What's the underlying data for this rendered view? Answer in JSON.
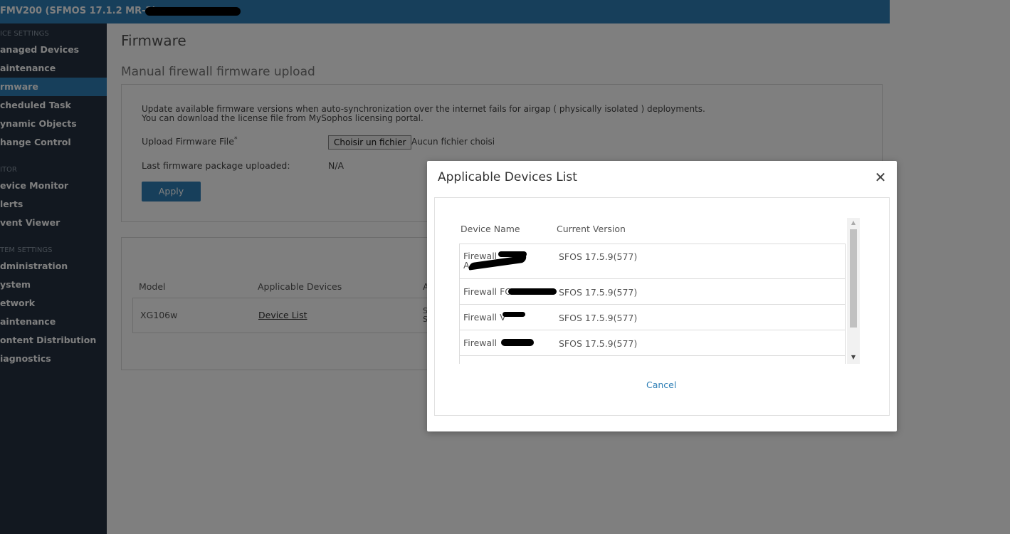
{
  "header": {
    "title": "FMV200 (SFMOS 17.1.2 MR-2) - "
  },
  "sidebar": {
    "sections": [
      {
        "label": "ICE SETTINGS",
        "items": [
          "anaged Devices",
          "aintenance",
          "rmware",
          "cheduled Task",
          "ynamic Objects",
          "hange Control"
        ]
      },
      {
        "label": "ITOR",
        "items": [
          "evice Monitor",
          "lerts",
          "vent Viewer"
        ]
      },
      {
        "label": "TEM SETTINGS",
        "items": [
          "dministration",
          "ystem",
          "etwork",
          "aintenance",
          "ontent Distribution",
          "iagnostics"
        ]
      }
    ],
    "active_item": "rmware"
  },
  "main": {
    "page_title": "Firmware",
    "section_title": "Manual firewall firmware upload",
    "description_line1": "Update available firmware versions when auto-synchronization over the internet fails for airgap ( physically isolated ) deployments.",
    "description_line2": "You can download the license file from MySophos licensing portal.",
    "upload_label": "Upload Firmware File",
    "required_marker": "*",
    "choose_file_button": "Choisir un fichier",
    "no_file_text": "Aucun fichier choisi",
    "last_uploaded_label": "Last firmware package uploaded:",
    "last_uploaded_value": "N/A",
    "apply_button": "Apply",
    "table": {
      "headers": [
        "Model",
        "Applicable Devices",
        "A"
      ],
      "rows": [
        {
          "model": "XG106w",
          "devices_link": "Device List",
          "partial_a": "S",
          "partial_b": "S"
        }
      ]
    }
  },
  "modal": {
    "title": "Applicable Devices List",
    "close_symbol": "✕",
    "columns": [
      "Device Name",
      "Current Version"
    ],
    "rows": [
      {
        "name_line1": "Firewall",
        "name_line2": "A",
        "version": "SFOS 17.5.9(577)"
      },
      {
        "name_line1": "Firewall FO",
        "name_line2": "",
        "version": "SFOS 17.5.9(577)"
      },
      {
        "name_line1": "Firewall V",
        "name_line2": "",
        "version": "SFOS 17.5.9(577)"
      },
      {
        "name_line1": "Firewall",
        "name_line2": "",
        "version": "SFOS 17.5.9(577)"
      }
    ],
    "cancel_button": "Cancel",
    "scroll_up_symbol": "▲",
    "scroll_down_symbol": "▼"
  }
}
